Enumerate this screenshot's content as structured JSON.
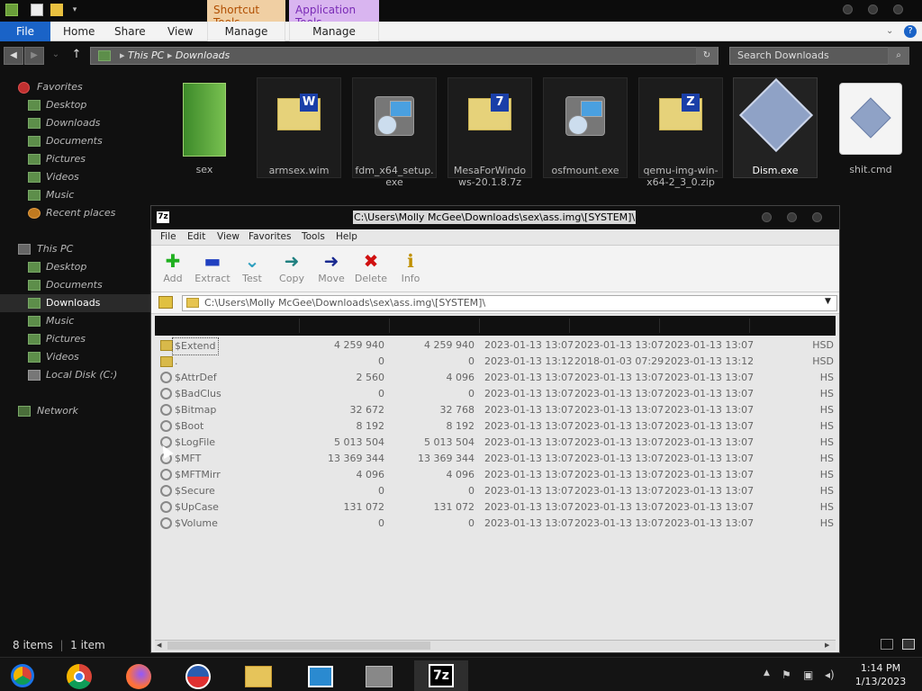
{
  "titlebar": {
    "context_tabs": [
      "Shortcut Tools",
      "Application Tools"
    ]
  },
  "ribbon": {
    "tabs": [
      "File",
      "Home",
      "Share",
      "View"
    ],
    "context_tabs": [
      "Manage",
      "Manage"
    ],
    "help": "?"
  },
  "address_bar": {
    "path": [
      "This PC",
      "Downloads"
    ],
    "search_placeholder": "Search Downloads"
  },
  "nav": {
    "favorites": "Favorites",
    "favorite_items": [
      "Desktop",
      "Downloads",
      "Documents",
      "Pictures",
      "Videos",
      "Music",
      "Recent places"
    ],
    "this_pc": "This PC",
    "pc_items": [
      "Desktop",
      "Documents",
      "Downloads",
      "Music",
      "Pictures",
      "Videos",
      "Local Disk (C:)"
    ],
    "network": "Network"
  },
  "files": [
    {
      "name": "sex",
      "icon": "green-book-icon"
    },
    {
      "name": "armsex.wim",
      "icon": "archive-w-icon"
    },
    {
      "name": "fdm_x64_setup.exe",
      "icon": "installer-icon"
    },
    {
      "name": "MesaForWindows-20.1.8.7z",
      "icon": "archive-7z-icon"
    },
    {
      "name": "osfmount.exe",
      "icon": "installer-icon"
    },
    {
      "name": "qemu-img-win-x64-2_3_0.zip",
      "icon": "archive-zip-icon"
    },
    {
      "name": "Dism.exe",
      "icon": "dism-icon"
    },
    {
      "name": "shit.cmd",
      "icon": "cmd-icon"
    }
  ],
  "status": {
    "items": "8 items",
    "selected": "1 item selected"
  },
  "zip": {
    "title": "C:\\Users\\Molly McGee\\Downloads\\sex\\ass.img\\[SYSTEM]\\",
    "menu": [
      "File",
      "Edit",
      "View",
      "Favorites",
      "Tools",
      "Help"
    ],
    "toolbar": [
      {
        "label": "Add",
        "icon": "add-icon"
      },
      {
        "label": "Extract",
        "icon": "extract-icon"
      },
      {
        "label": "Test",
        "icon": "test-icon"
      },
      {
        "label": "Copy",
        "icon": "copy-icon"
      },
      {
        "label": "Move",
        "icon": "move-icon"
      },
      {
        "label": "Delete",
        "icon": "delete-icon"
      },
      {
        "label": "Info",
        "icon": "info-icon"
      }
    ],
    "path": "C:\\Users\\Molly McGee\\Downloads\\sex\\ass.img\\[SYSTEM]\\",
    "rows": [
      {
        "name": "$Extend",
        "size": "4 259 940",
        "packed": "4 259 940",
        "modified": "2023-01-13 13:07",
        "created": "2023-01-13 13:07",
        "accessed": "2023-01-13 13:07",
        "attr": "HSD",
        "type": "folder"
      },
      {
        "name": ".",
        "size": "0",
        "packed": "0",
        "modified": "2023-01-13 13:12",
        "created": "2018-01-03 07:29",
        "accessed": "2023-01-13 13:12",
        "attr": "HSD",
        "type": "folder"
      },
      {
        "name": "$AttrDef",
        "size": "2 560",
        "packed": "4 096",
        "modified": "2023-01-13 13:07",
        "created": "2023-01-13 13:07",
        "accessed": "2023-01-13 13:07",
        "attr": "HS",
        "type": "file"
      },
      {
        "name": "$BadClus",
        "size": "0",
        "packed": "0",
        "modified": "2023-01-13 13:07",
        "created": "2023-01-13 13:07",
        "accessed": "2023-01-13 13:07",
        "attr": "HS",
        "type": "file"
      },
      {
        "name": "$Bitmap",
        "size": "32 672",
        "packed": "32 768",
        "modified": "2023-01-13 13:07",
        "created": "2023-01-13 13:07",
        "accessed": "2023-01-13 13:07",
        "attr": "HS",
        "type": "file"
      },
      {
        "name": "$Boot",
        "size": "8 192",
        "packed": "8 192",
        "modified": "2023-01-13 13:07",
        "created": "2023-01-13 13:07",
        "accessed": "2023-01-13 13:07",
        "attr": "HS",
        "type": "file"
      },
      {
        "name": "$LogFile",
        "size": "5 013 504",
        "packed": "5 013 504",
        "modified": "2023-01-13 13:07",
        "created": "2023-01-13 13:07",
        "accessed": "2023-01-13 13:07",
        "attr": "HS",
        "type": "file"
      },
      {
        "name": "$MFT",
        "size": "13 369 344",
        "packed": "13 369 344",
        "modified": "2023-01-13 13:07",
        "created": "2023-01-13 13:07",
        "accessed": "2023-01-13 13:07",
        "attr": "HS",
        "type": "file"
      },
      {
        "name": "$MFTMirr",
        "size": "4 096",
        "packed": "4 096",
        "modified": "2023-01-13 13:07",
        "created": "2023-01-13 13:07",
        "accessed": "2023-01-13 13:07",
        "attr": "HS",
        "type": "file"
      },
      {
        "name": "$Secure",
        "size": "0",
        "packed": "0",
        "modified": "2023-01-13 13:07",
        "created": "2023-01-13 13:07",
        "accessed": "2023-01-13 13:07",
        "attr": "HS",
        "type": "file"
      },
      {
        "name": "$UpCase",
        "size": "131 072",
        "packed": "131 072",
        "modified": "2023-01-13 13:07",
        "created": "2023-01-13 13:07",
        "accessed": "2023-01-13 13:07",
        "attr": "HS",
        "type": "file"
      },
      {
        "name": "$Volume",
        "size": "0",
        "packed": "0",
        "modified": "2023-01-13 13:07",
        "created": "2023-01-13 13:07",
        "accessed": "2023-01-13 13:07",
        "attr": "HS",
        "type": "file"
      }
    ]
  },
  "taskbar": {
    "time": "1:14 PM",
    "date": "1/13/2023",
    "apps": [
      "chrome-remote-icon",
      "chrome-icon",
      "firefox-icon",
      "obama-logo-icon",
      "file-explorer-icon",
      "remote-app-icon",
      "archive-box-icon",
      "7zip-icon"
    ]
  }
}
